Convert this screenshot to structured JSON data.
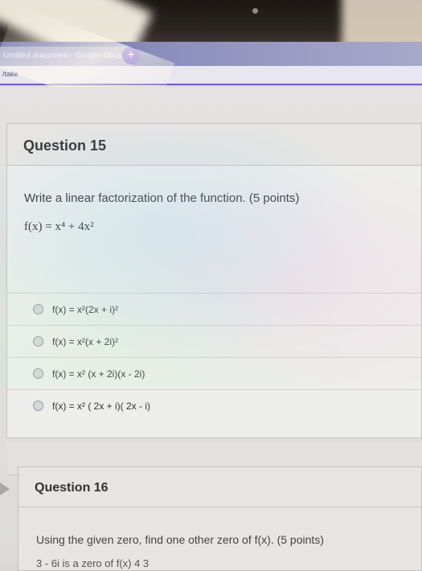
{
  "browser": {
    "tab_title": "Untitled document - Google Docs",
    "new_tab": "+",
    "url": "/take"
  },
  "question1": {
    "title": "Question 15",
    "prompt": "Write a linear factorization of the function. (5 points)",
    "function": "f(x) = x⁴ + 4x²",
    "options": [
      {
        "label": "f(x) = x²(2x + i)²"
      },
      {
        "label": "f(x) = x²(x + 2i)²"
      },
      {
        "label": "f(x) = x² (x + 2i)(x - 2i)"
      },
      {
        "label": "f(x) = x² ( 2x + i)( 2x - i)"
      }
    ]
  },
  "question2": {
    "title": "Question 16",
    "prompt": "Using the given zero, find one other zero of f(x). (5 points)",
    "cut_text": "3 - 6i is a zero of f(x)   4    3"
  },
  "colors": {
    "accent": "#6b5fbd",
    "tab_gradient_start": "#6a6fa6"
  }
}
